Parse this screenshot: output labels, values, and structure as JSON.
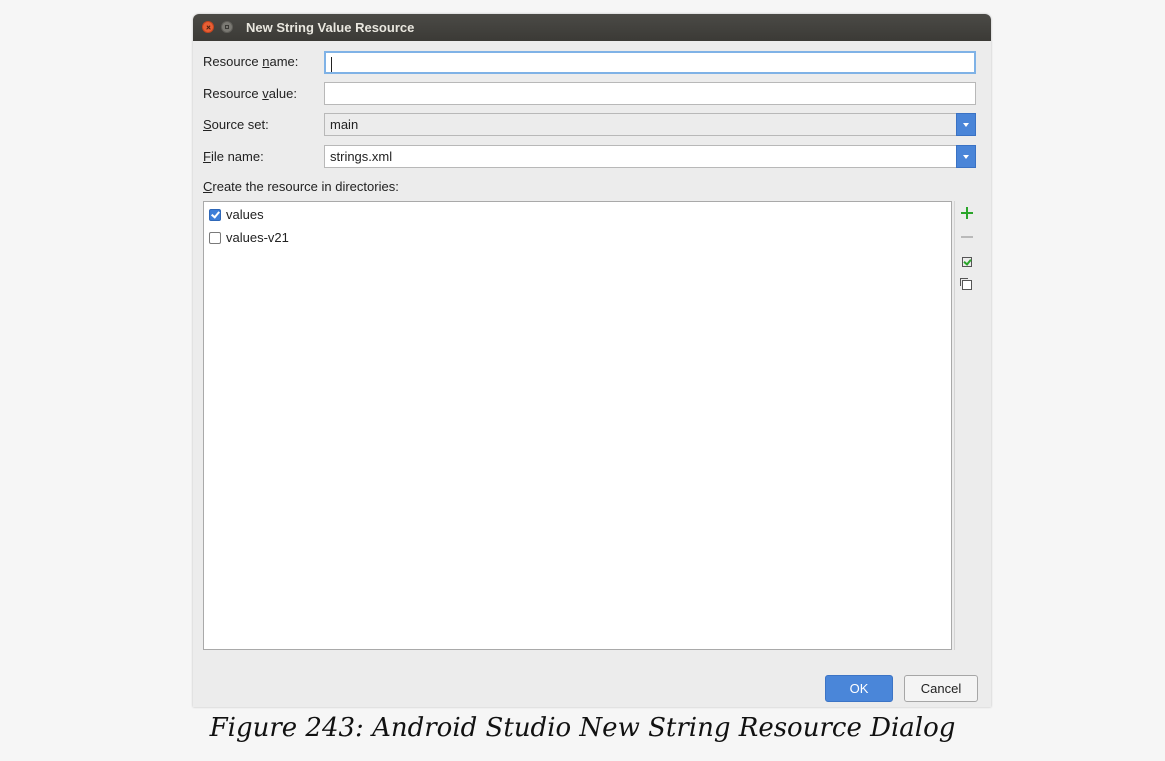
{
  "dialog": {
    "title": "New String Value Resource",
    "fields": {
      "resource_name": {
        "label_mnemonic_pre": "Resource ",
        "label_mnemonic_key": "n",
        "label_mnemonic_post": "ame:",
        "value": ""
      },
      "resource_value": {
        "label_mnemonic_pre": "Resource ",
        "label_mnemonic_key": "v",
        "label_mnemonic_post": "alue:",
        "value": ""
      },
      "source_set": {
        "label_mnemonic_pre": "",
        "label_mnemonic_key": "S",
        "label_mnemonic_post": "ource set:",
        "value": "main"
      },
      "file_name": {
        "label_mnemonic_pre": "",
        "label_mnemonic_key": "F",
        "label_mnemonic_post": "ile name:",
        "value": "strings.xml"
      }
    },
    "directories": {
      "label_mnemonic_key": "C",
      "label_rest": "reate the resource in directories:",
      "items": [
        {
          "label": "values",
          "checked": true
        },
        {
          "label": "values-v21",
          "checked": false
        }
      ],
      "toolbar_icons": [
        "add-icon",
        "remove-icon",
        "select-all-icon",
        "unselect-all-icon"
      ]
    },
    "buttons": {
      "ok": "OK",
      "cancel": "Cancel"
    },
    "colors": {
      "accent": "#4a86d9",
      "titlebar": "#3f3e3a",
      "add_green": "#2aa52a"
    }
  },
  "caption": "Figure 243: Android Studio New String Resource Dialog"
}
